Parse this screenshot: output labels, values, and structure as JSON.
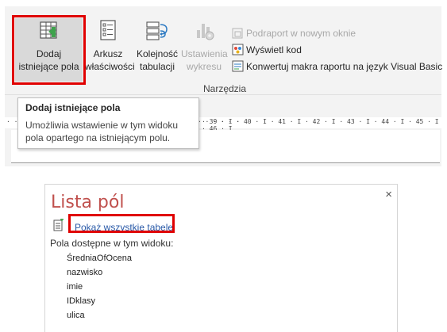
{
  "ribbon": {
    "buttons": [
      {
        "line1": "Dodaj",
        "line2": "istniejące pola",
        "icon": "add-existing-fields-icon"
      },
      {
        "line1": "Arkusz",
        "line2": "właściwości",
        "icon": "property-sheet-icon"
      },
      {
        "line1": "Kolejność",
        "line2": "tabulacji",
        "icon": "tab-order-icon"
      },
      {
        "line1": "Ustawienia",
        "line2": "wykresu",
        "icon": "chart-settings-icon"
      }
    ],
    "small_items": [
      {
        "label": "Podraport w nowym oknie",
        "icon": "subreport-icon"
      },
      {
        "label": "Wyświetl kod",
        "icon": "view-code-icon"
      },
      {
        "label": "Konwertuj makra raportu na język Visual Basic",
        "icon": "convert-macros-icon"
      }
    ],
    "group_label": "Narzędzia"
  },
  "tooltip": {
    "title": "Dodaj istniejące pola",
    "body_line1": "Umożliwia wstawienie w tym widoku",
    "body_line2": "pola opartego na istniejącym polu."
  },
  "ruler": {
    "left_marks": "· · · · · · · · · · · · · · · · · · · · · · · · · · · · · · ·",
    "right_marks": "· 39 · I · 40 · I · 41 · I · 42 · I · 43 · I · 44 · I · 45 · I · 46 · I"
  },
  "field_pane": {
    "title": "Lista pól",
    "close": "×",
    "show_all_tables": "Pokaż wszystkie tabele",
    "caption": "Pola dostępne w tym widoku:",
    "fields": [
      "ŚredniaOfOcena",
      "nazwisko",
      "imie",
      "IDklasy",
      "ulica"
    ]
  },
  "colors": {
    "highlight": "#e00000",
    "pane_title": "#c0504d",
    "link": "#2a5aa8"
  }
}
